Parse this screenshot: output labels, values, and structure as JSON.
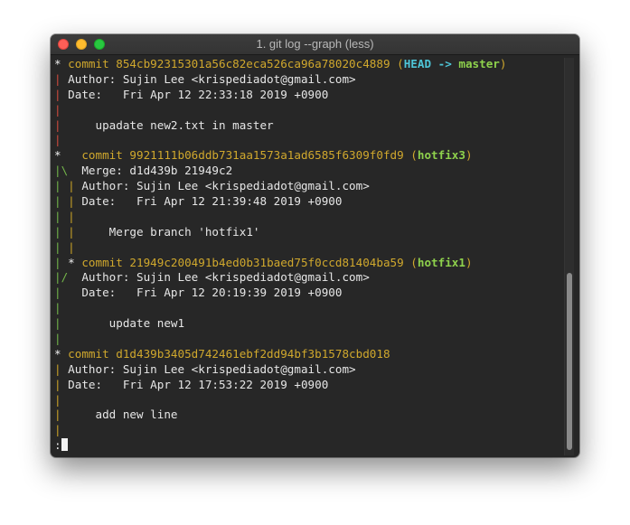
{
  "window": {
    "title": "1. git log --graph (less)"
  },
  "log": {
    "c1": {
      "graph": "* ",
      "word": "commit ",
      "hash": "854cb92315301a56c82eca526ca96a78020c4889",
      "open": " (",
      "head": "HEAD -> ",
      "branch": "master",
      "close": ")",
      "g_author": "| ",
      "author": "Author: Sujin Lee <krispediadot@gmail.com>",
      "g_date": "| ",
      "date": "Date:   Fri Apr 12 22:33:18 2019 +0900",
      "g_blank1": "|",
      "g_msg": "| ",
      "message": "    upadate new2.txt in master",
      "g_blank2": "|"
    },
    "c2": {
      "graph": "*   ",
      "word": "commit ",
      "hash": "9921111b06ddb731aa1573a1ad6585f6309f0fd9",
      "open": " (",
      "branch": "hotfix3",
      "close": ")",
      "g_merge": "|\\  ",
      "merge": "Merge: d1d439b 21949c2",
      "g_author_a": "| ",
      "g_author_b": "| ",
      "author": "Author: Sujin Lee <krispediadot@gmail.com>",
      "g_date_a": "| ",
      "g_date_b": "| ",
      "date": "Date:   Fri Apr 12 21:39:48 2019 +0900",
      "g_blank1_a": "| ",
      "g_blank1_b": "|",
      "g_msg_a": "| ",
      "g_msg_b": "| ",
      "message": "    Merge branch 'hotfix1'",
      "g_blank2_a": "| ",
      "g_blank2_b": "|"
    },
    "c3": {
      "g_a": "| ",
      "graph": "* ",
      "word": "commit ",
      "hash": "21949c200491b4ed0b31baed75f0ccd81404ba59",
      "open": " (",
      "branch": "hotfix1",
      "close": ")",
      "g_author": "|/  ",
      "author": "Author: Sujin Lee <krispediadot@gmail.com>",
      "g_date": "|   ",
      "date": "Date:   Fri Apr 12 20:19:39 2019 +0900",
      "g_blank1": "|",
      "g_msg": "|   ",
      "message": "    update new1",
      "g_blank2": "|"
    },
    "c4": {
      "graph": "* ",
      "word": "commit ",
      "hash": "d1d439b3405d742461ebf2dd94bf3b1578cbd018",
      "g_author": "| ",
      "author": "Author: Sujin Lee <krispediadot@gmail.com>",
      "g_date": "| ",
      "date": "Date:   Fri Apr 12 17:53:22 2019 +0900",
      "g_blank1": "|",
      "g_msg": "| ",
      "message": "    add new line",
      "g_blank2": "|"
    }
  },
  "prompt": ":",
  "colors": {
    "background": "#272727",
    "hash": "#d0a82d",
    "head": "#4ec5d7",
    "branch": "#8ed14c",
    "graph_red": "#d04a3e",
    "graph_green": "#74b74a",
    "graph_yellow": "#c9a227"
  }
}
